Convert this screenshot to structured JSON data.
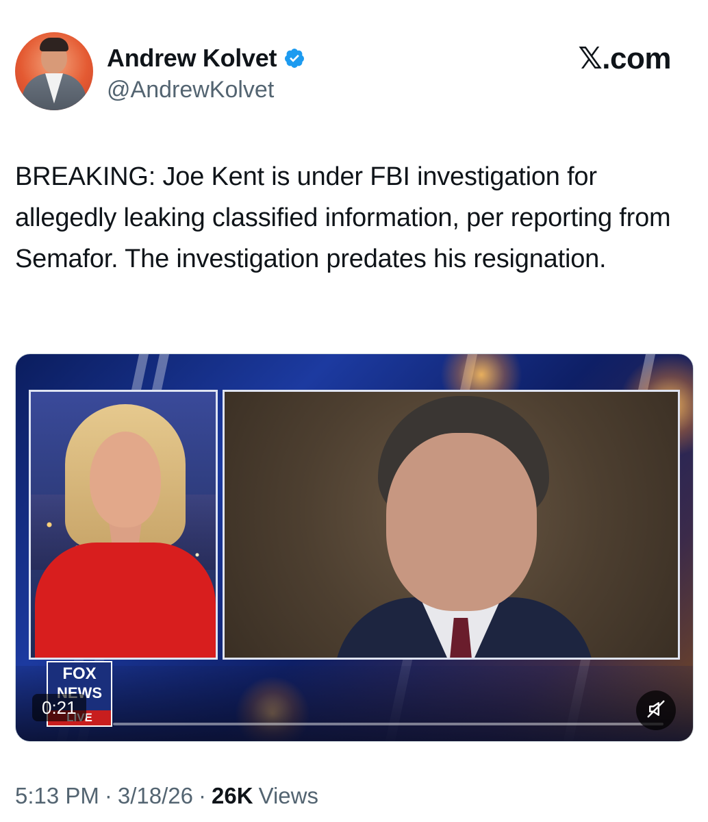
{
  "author": {
    "display_name": "Andrew Kolvet",
    "handle": "@AndrewKolvet",
    "verified": true
  },
  "brand": "𝕏.com",
  "tweet": {
    "text": "BREAKING: Joe Kent is under FBI investigation for allegedly leaking classified information, per reporting from Semafor. The investigation predates his resignation."
  },
  "media": {
    "type": "video",
    "duration": "0:21",
    "progress": 0.0,
    "muted": true,
    "logo": {
      "line1": "FOX",
      "line2": "NEWS",
      "line3": "LIVE"
    }
  },
  "footer": {
    "time": "5:13 PM",
    "date": "3/18/26",
    "separator": "·",
    "views_count": "26K",
    "views_label": "Views"
  },
  "colors": {
    "verified_badge": "#1d9bf0",
    "secondary_text": "#536471",
    "primary_text": "#0f1419"
  }
}
